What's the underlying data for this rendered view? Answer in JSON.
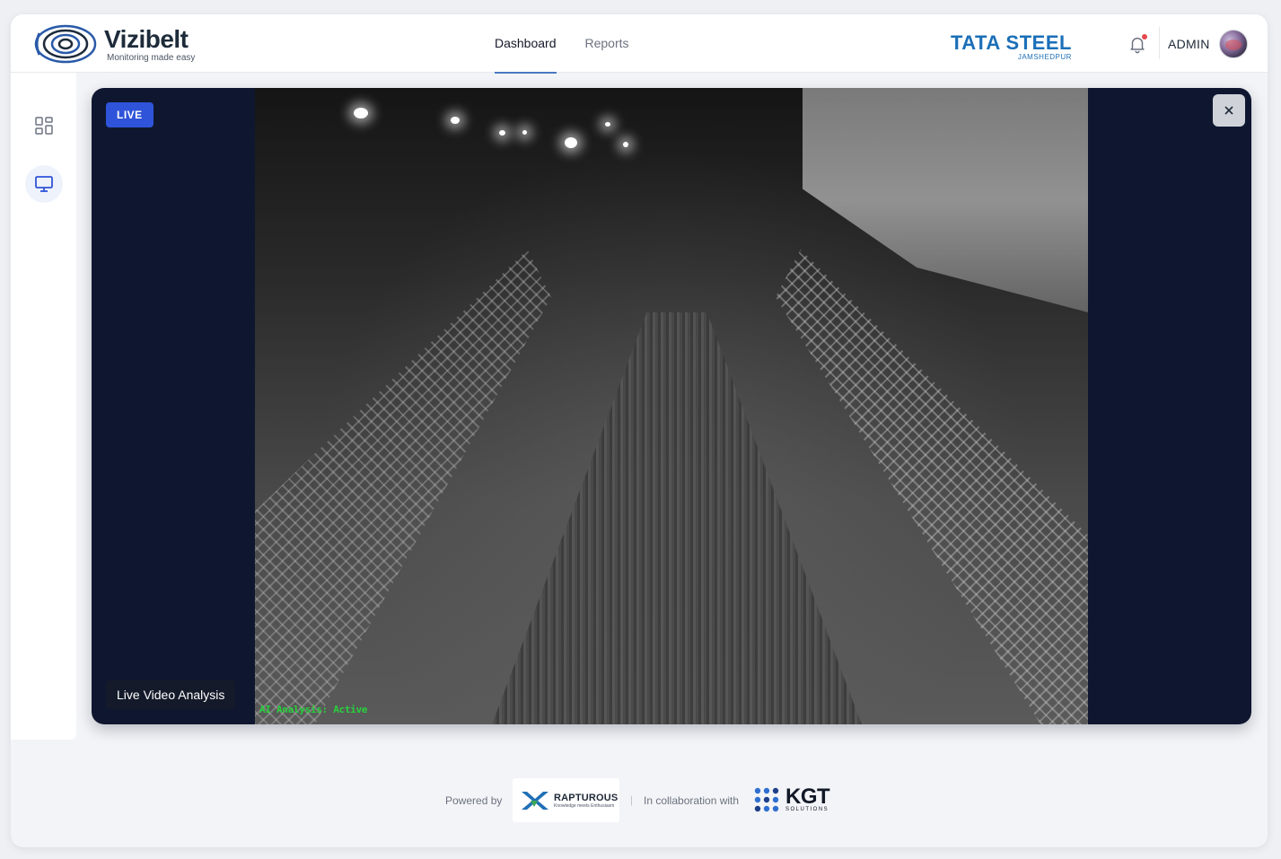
{
  "header": {
    "brand_name": "Vizibelt",
    "brand_tagline": "Monitoring made easy",
    "nav": [
      {
        "label": "Dashboard",
        "active": true
      },
      {
        "label": "Reports",
        "active": false
      }
    ],
    "partner_name": "TATA STEEL",
    "partner_location": "JAMSHEDPUR",
    "user_name": "ADMIN",
    "notification_unread": true
  },
  "sidebar": {
    "items": [
      {
        "icon": "dashboard-grid-icon",
        "active": false
      },
      {
        "icon": "monitor-icon",
        "active": true
      }
    ]
  },
  "video": {
    "badge": "LIVE",
    "caption": "Live Video Analysis",
    "overlay_status": "AI Analysis: Active",
    "close_icon": "close-icon"
  },
  "footer": {
    "powered_by_label": "Powered by",
    "powered_by_name": "RAPTUROUS",
    "powered_by_tagline": "Knowledge meets Enthusiasm",
    "separator": "|",
    "collab_label": "In collaboration with",
    "collab_name": "KGT",
    "collab_sub": "SOLUTIONS"
  },
  "colors": {
    "accent": "#2f54d9",
    "nav_underline": "#4a78c2",
    "video_bg": "#0f1730",
    "partner_blue": "#1b6fb8",
    "status_green": "#27d13b"
  }
}
